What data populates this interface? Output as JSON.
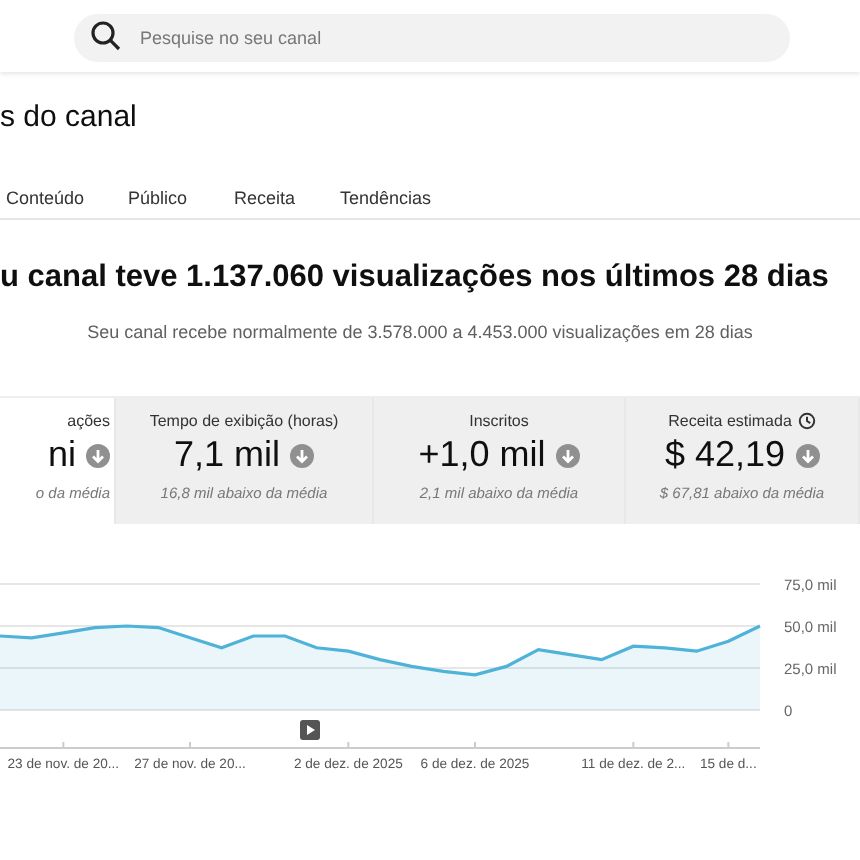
{
  "search": {
    "placeholder": "Pesquise no seu canal"
  },
  "page_title": "s do canal",
  "tabs": [
    {
      "label": "Conteúdo",
      "selected": false
    },
    {
      "label": "Público",
      "selected": false
    },
    {
      "label": "Receita",
      "selected": false
    },
    {
      "label": "Tendências",
      "selected": false
    }
  ],
  "headline": "u canal teve 1.137.060 visualizações nos últimos 28 dias",
  "subtitle": "Seu canal recebe normalmente de 3.578.000 a 4.453.000 visualizações em 28 dias",
  "metrics": [
    {
      "label": "ações",
      "value": "ni",
      "note": "o da média",
      "selected": true
    },
    {
      "label": "Tempo de exibição (horas)",
      "value": "7,1 mil",
      "note": "16,8 mil abaixo da média",
      "selected": false
    },
    {
      "label": "Inscritos",
      "value": "+1,0 mil",
      "note": "2,1 mil abaixo da média",
      "selected": false
    },
    {
      "label": "Receita estimada",
      "value": "$ 42,19",
      "note": "$ 67,81 abaixo da média",
      "selected": false,
      "clock": true
    }
  ],
  "chart": {
    "chart_data": {
      "type": "area",
      "categories": [
        null,
        null,
        "23 de nov. de 20...",
        null,
        null,
        null,
        "27 de nov. de 20...",
        null,
        null,
        null,
        null,
        "2 de dez. de 2025",
        null,
        null,
        null,
        "6 de dez. de 2025",
        null,
        null,
        null,
        null,
        "11 de dez. de 2...",
        null,
        null,
        "15 de d...",
        null
      ],
      "series": [
        {
          "color": "#4fb3d9",
          "values": [
            44,
            43,
            46,
            49,
            50,
            49,
            43,
            37,
            44,
            44,
            37,
            35,
            30,
            26,
            23,
            21,
            26,
            36,
            33,
            30,
            38,
            37,
            35,
            41,
            50
          ]
        }
      ],
      "ylim": [
        0,
        75
      ],
      "yticks": [
        {
          "value": 0,
          "label": "0"
        },
        {
          "value": 25,
          "label": "25,0 mil"
        },
        {
          "value": 50,
          "label": "50,0 mil"
        },
        {
          "value": 75,
          "label": "75,0 mil"
        }
      ]
    }
  }
}
